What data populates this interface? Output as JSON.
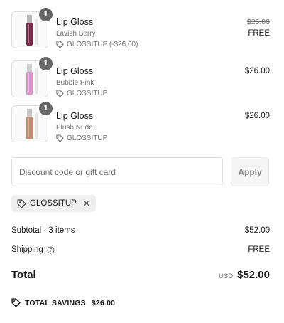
{
  "line_items": [
    {
      "quantity": "1",
      "name": "Lip Gloss",
      "variant": "Lavish Berry",
      "discount": "GLOSSITUP (-$26.00)",
      "original_price": "$26.00",
      "price": "FREE",
      "swatch": "#7a2a48"
    },
    {
      "quantity": "1",
      "name": "Lip Gloss",
      "variant": "Bubble Pink",
      "discount": "GLOSSITUP",
      "original_price": "",
      "price": "$26.00",
      "swatch": "#d98fc8"
    },
    {
      "quantity": "1",
      "name": "Lip Gloss",
      "variant": "Plush Nude",
      "discount": "GLOSSITUP",
      "original_price": "",
      "price": "$26.00",
      "swatch": "#c08a6a"
    }
  ],
  "discount": {
    "placeholder": "Discount code or gift card",
    "apply_label": "Apply",
    "applied_code": "GLOSSITUP"
  },
  "summary": {
    "subtotal_label": "Subtotal · 3 items",
    "subtotal_value": "$52.00",
    "shipping_label": "Shipping",
    "shipping_value": "FREE",
    "total_label": "Total",
    "currency": "USD",
    "total_value": "$52.00",
    "savings_label": "TOTAL SAVINGS",
    "savings_value": "$26.00"
  }
}
